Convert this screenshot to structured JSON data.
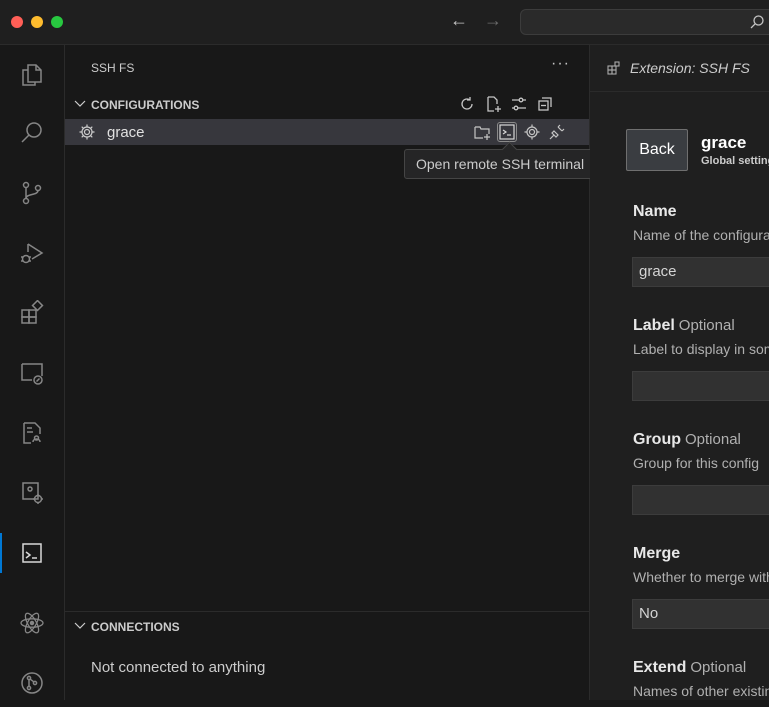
{
  "titlebar": {
    "back_arrow": "←",
    "forward_arrow": "→",
    "search_icon": "search-icon"
  },
  "activity_bar": [
    {
      "name": "explorer-icon"
    },
    {
      "name": "search-icon"
    },
    {
      "name": "source-control-icon"
    },
    {
      "name": "run-debug-icon"
    },
    {
      "name": "extensions-icon"
    },
    {
      "name": "remote-explorer-icon"
    },
    {
      "name": "notebook-icon"
    },
    {
      "name": "remote-settings-icon"
    },
    {
      "name": "terminal-icon",
      "active": true
    },
    {
      "name": "react-icon"
    },
    {
      "name": "git-graph-icon"
    }
  ],
  "sidebar": {
    "title": "SSH FS",
    "more": "···",
    "configurations": {
      "header": "CONFIGURATIONS",
      "actions": [
        "refresh-icon",
        "new-file-icon",
        "settings-sliders-icon",
        "collapse-all-icon"
      ],
      "items": [
        {
          "label": "grace",
          "actions": [
            "add-workspace-folder-icon",
            "open-terminal-icon",
            "edit-settings-icon",
            "connect-plug-icon"
          ]
        }
      ]
    },
    "tooltip": "Open remote SSH terminal",
    "connections": {
      "header": "CONNECTIONS",
      "empty": "Not connected to anything"
    }
  },
  "editor": {
    "tab_label": "Extension: SSH FS",
    "back_button": "Back",
    "header_title": "grace",
    "header_subtitle": "Global settings",
    "fields": [
      {
        "label": "Name",
        "optional": "",
        "description": "Name of the configuration",
        "value": "grace"
      },
      {
        "label": "Label",
        "optional": "Optional",
        "description": "Label to display in some UI places",
        "value": ""
      },
      {
        "label": "Group",
        "optional": "Optional",
        "description": "Group for this config",
        "value": ""
      },
      {
        "label": "Merge",
        "optional": "",
        "description": "Whether to merge with",
        "value": "No"
      },
      {
        "label": "Extend",
        "optional": "Optional",
        "description": "Names of other existing configs",
        "value": ""
      }
    ]
  },
  "colors": {
    "accent": "#0078d4",
    "selection": "#37373d",
    "background": "#181818"
  }
}
